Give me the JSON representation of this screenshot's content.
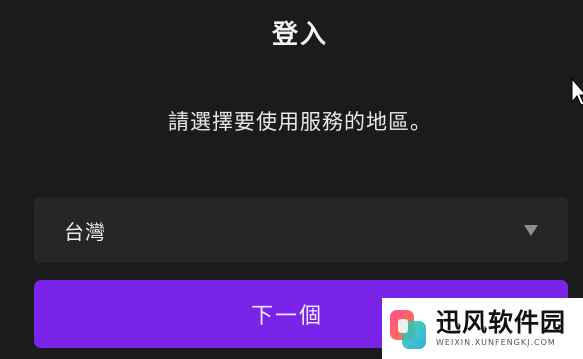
{
  "dialog": {
    "title": "登入",
    "subtitle": "請選擇要使用服務的地區。"
  },
  "region_select": {
    "selected": "台灣",
    "icon": "chevron-down-icon"
  },
  "next_button": {
    "label": "下一個"
  },
  "watermark": {
    "name": "迅风软件园",
    "url": "WEIXIN.XUNFENGKJ.COM"
  },
  "colors": {
    "background": "#1b1b1d",
    "select_bg": "#262628",
    "accent": "#7a24ea"
  }
}
